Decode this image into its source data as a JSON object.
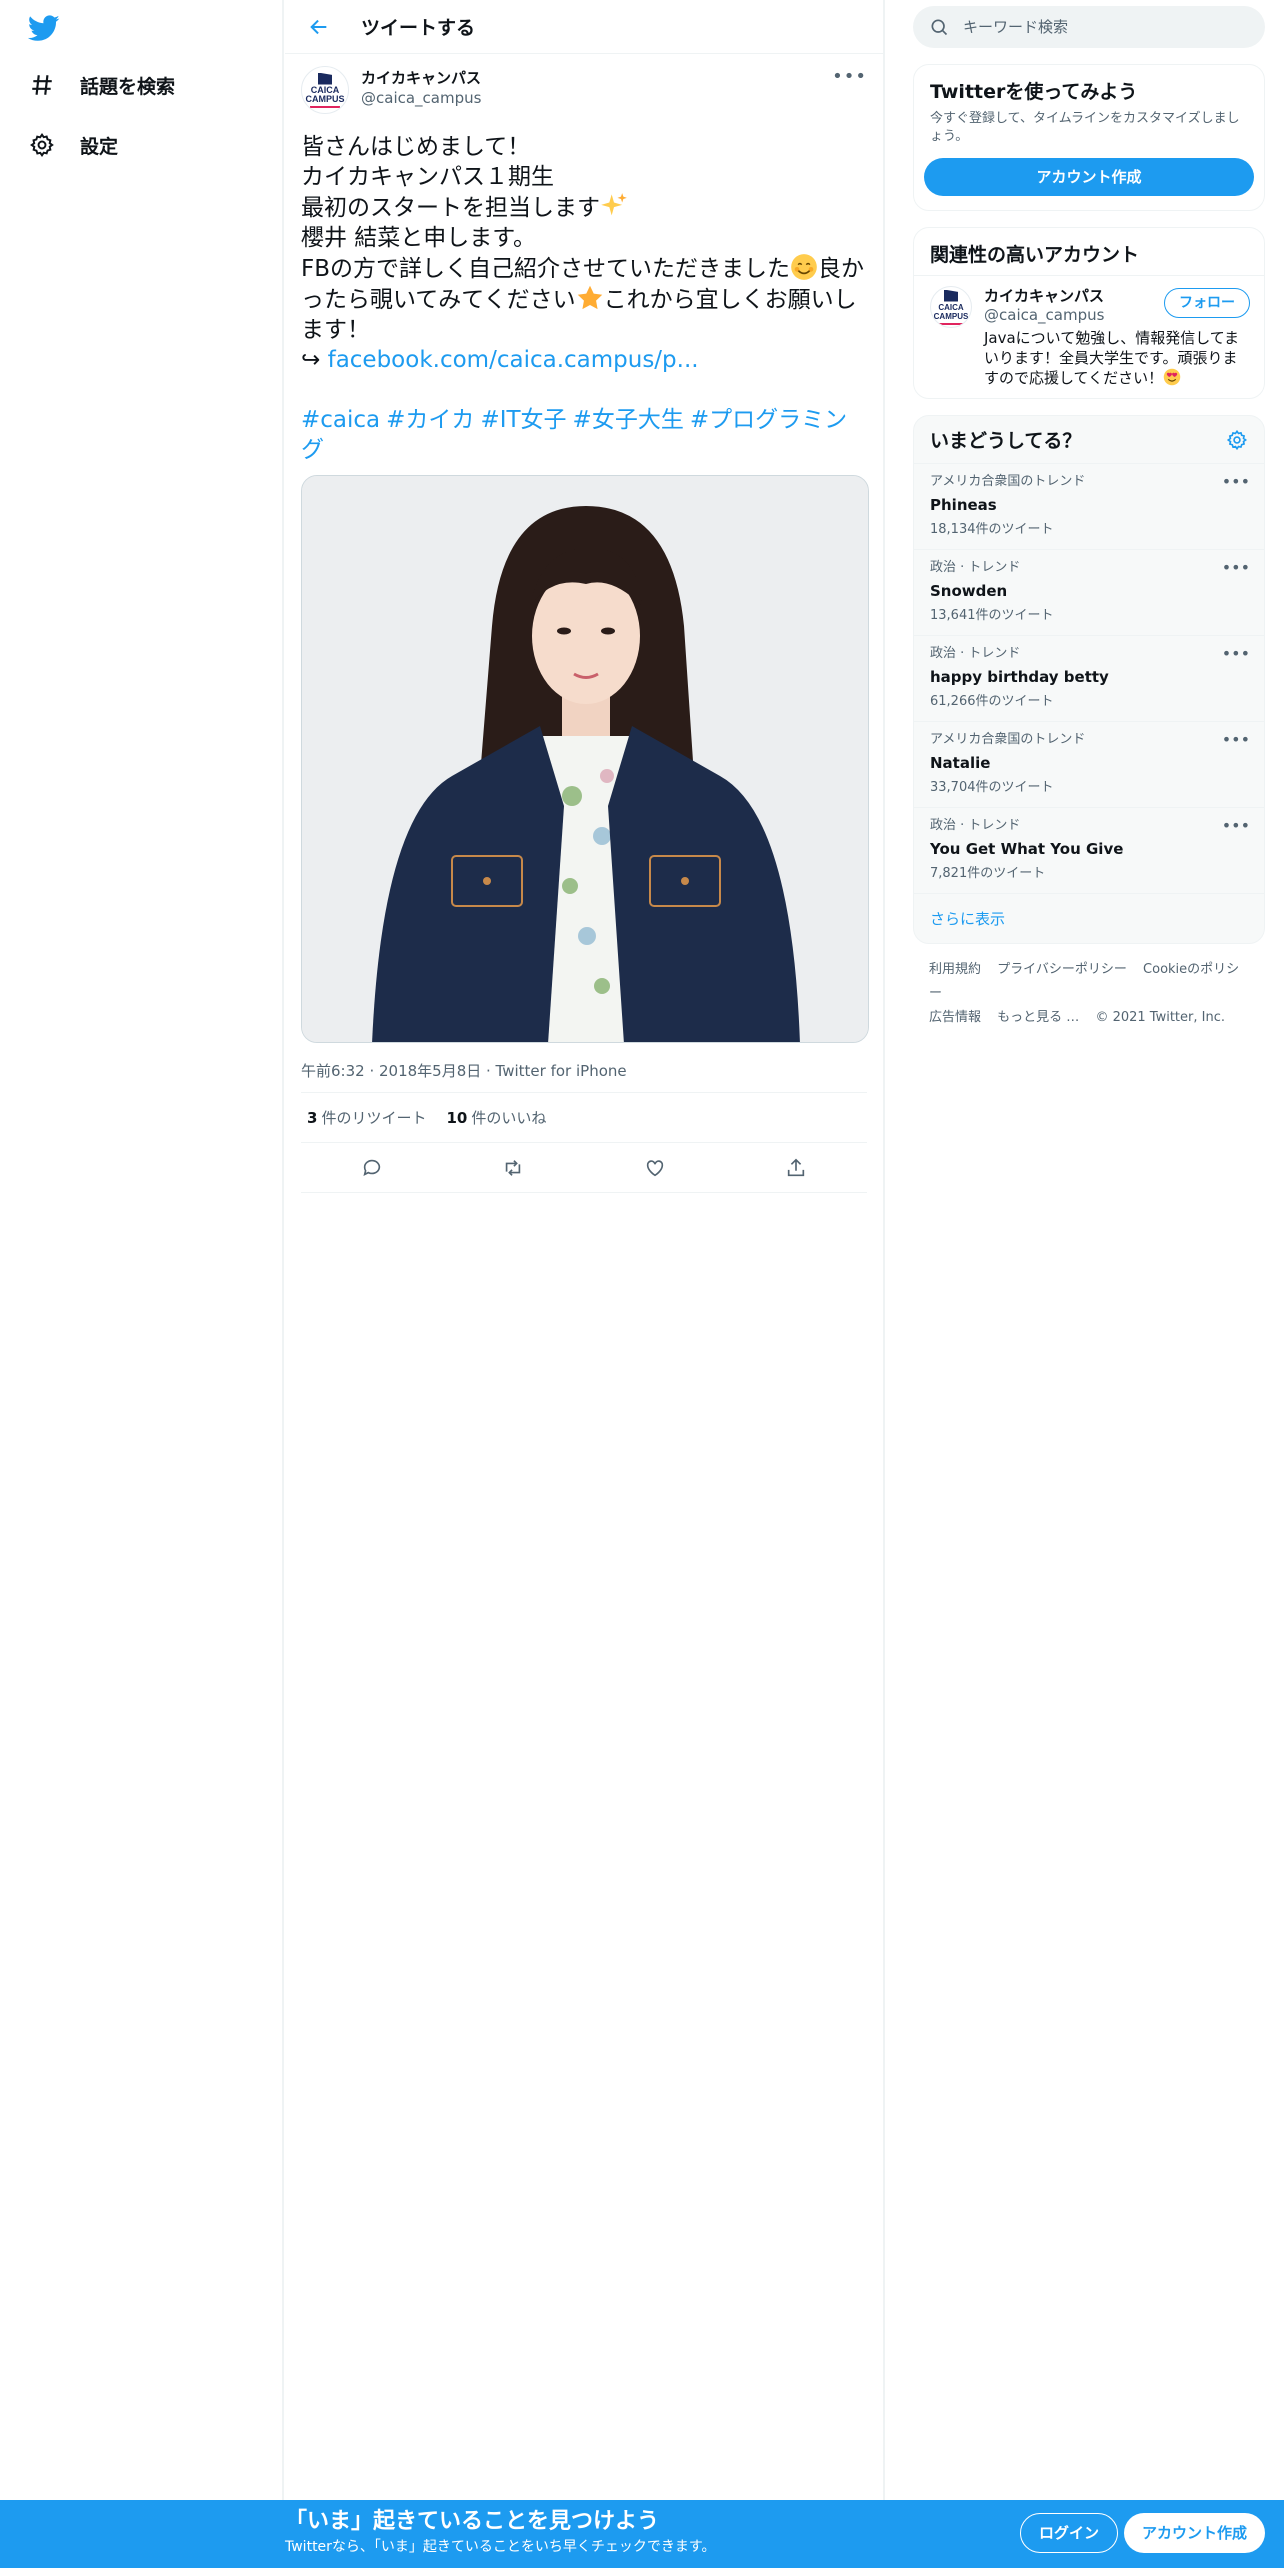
{
  "nav": {
    "explore_label": "話題を検索",
    "settings_label": "設定"
  },
  "header": {
    "title": "ツイートする"
  },
  "tweet": {
    "author_name": "カイカキャンパス",
    "author_handle": "@caica_campus",
    "avatar_text_1": "CAICA",
    "avatar_text_2": "CAMPUS",
    "line1": "皆さんはじめまして！",
    "line2": "カイカキャンパス１期生",
    "line3": "最初のスタートを担当します",
    "line4": "櫻井 結菜と申します。",
    "line5a": "FBの方で詳しく自己紹介させていただきました",
    "line5b": "良かったら覗いてみてください",
    "line5c": "これから宜しくお願いします！",
    "arrow": "↪ ",
    "link": "facebook.com/caica.campus/p...",
    "hashtags": [
      "#caica",
      "#カイカ",
      "#IT女子",
      "#女子大生",
      "#プログラミング"
    ],
    "meta": "午前6:32 · 2018年5月8日 · Twitter for iPhone",
    "retweet_count": "3",
    "retweet_label": "件のリツイート",
    "like_count": "10",
    "like_label": "件のいいね"
  },
  "sidebar": {
    "search_placeholder": "キーワード検索",
    "signup_card": {
      "title": "Twitterを使ってみよう",
      "subtitle": "今すぐ登録して、タイムラインをカスタマイズしましょう。",
      "button": "アカウント作成"
    },
    "relevant": {
      "title": "関連性の高いアカウント",
      "name": "カイカキャンパス",
      "handle": "@caica_campus",
      "bio": "Javaについて勉強し、情報発信してまいります！全員大学生です。頑張りますので応援してください！",
      "follow": "フォロー"
    },
    "trends": {
      "title": "いまどうしてる？",
      "items": [
        {
          "category": "アメリカ合衆国のトレンド",
          "name": "Phineas",
          "count": "18,134件のツイート"
        },
        {
          "category": "政治 · トレンド",
          "name": "Snowden",
          "count": "13,641件のツイート"
        },
        {
          "category": "政治 · トレンド",
          "name": "happy birthday betty",
          "count": "61,266件のツイート"
        },
        {
          "category": "アメリカ合衆国のトレンド",
          "name": "Natalie",
          "count": "33,704件のツイート"
        },
        {
          "category": "政治 · トレンド",
          "name": "You Get What You Give",
          "count": "7,821件のツイート"
        }
      ],
      "show_more": "さらに表示"
    },
    "footer": {
      "terms": "利用規約",
      "privacy": "プライバシーポリシー",
      "cookie": "Cookieのポリシー",
      "ads": "広告情報",
      "more": "もっと見る …",
      "copyright": "© 2021 Twitter, Inc."
    }
  },
  "bottom": {
    "title": "「いま」起きていることを見つけよう",
    "subtitle": "Twitterなら、「いま」起きていることをいち早くチェックできます。",
    "login": "ログイン",
    "signup": "アカウント作成"
  },
  "colors": {
    "brand": "#1d9bf0",
    "text": "#0f1419",
    "muted": "#536471"
  }
}
